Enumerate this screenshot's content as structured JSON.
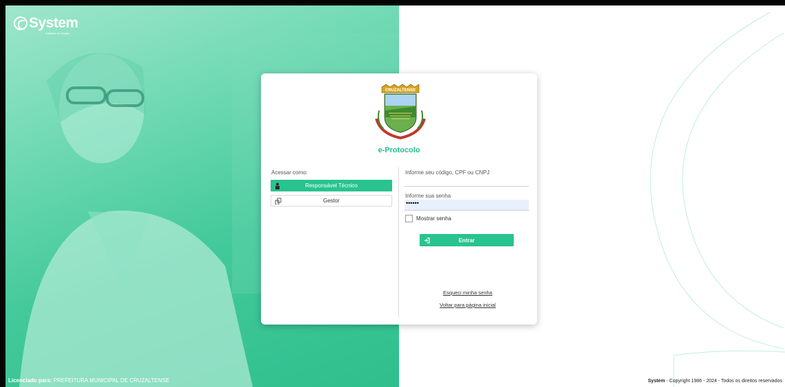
{
  "brand": {
    "name": "System",
    "tagline": "Software de Gestão"
  },
  "footer": {
    "license_label": "Licenciado para:",
    "license_value": "PREFEITURA MUNICIPAL DE CRUZALTENSE",
    "copyright_brand": "System",
    "copyright_text": "- Copyright 1986 - 2024 - Todos os direitos reservados"
  },
  "login": {
    "crest_banner": "CRUZALTENSE",
    "app_title": "e-Protocolo",
    "access_label": "Acessar como:",
    "roles": [
      {
        "label": "Responsável Técnico",
        "active": true,
        "icon": "person-icon"
      },
      {
        "label": "Gestor",
        "active": false,
        "icon": "building-icon"
      }
    ],
    "user_label": "Informe seu código, CPF ou CNPJ",
    "user_value": "",
    "password_label": "Informe sua senha",
    "password_value": "••••••",
    "show_password_label": "Mostrar senha",
    "submit_label": "Entrar",
    "forgot_link": "Esqueci minha senha",
    "home_link": "Voltar para página inicial"
  },
  "colors": {
    "accent": "#28c38f",
    "title": "#26be8f"
  }
}
